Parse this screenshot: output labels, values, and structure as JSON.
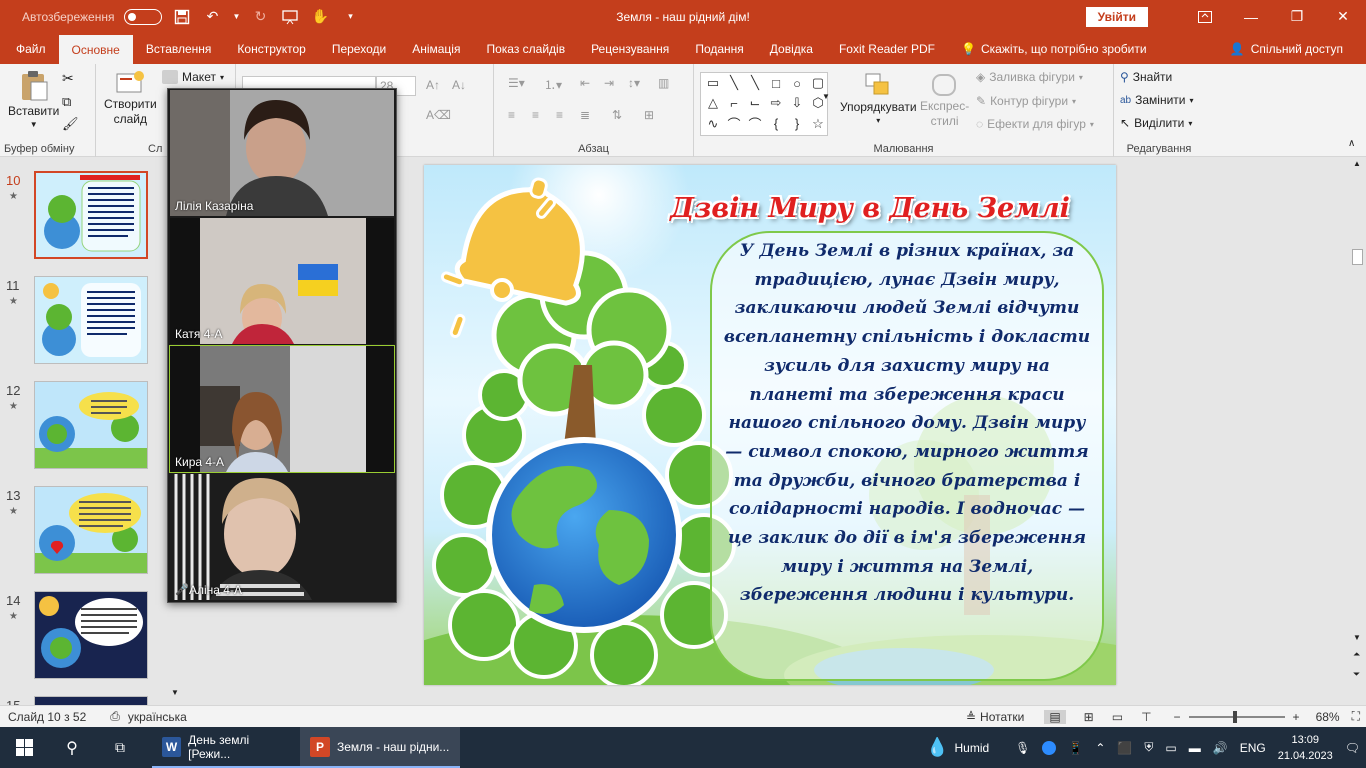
{
  "titlebar": {
    "autosave_label": "Автозбереження",
    "title": "Земля - наш рідний дім!",
    "signin": "Увійти"
  },
  "tabs": [
    "Файл",
    "Основне",
    "Вставлення",
    "Конструктор",
    "Переходи",
    "Анімація",
    "Показ слайдів",
    "Рецензування",
    "Подання",
    "Довідка",
    "Foxit Reader PDF"
  ],
  "tell_me": "Скажіть, що потрібно зробити",
  "share": "Спільний доступ",
  "ribbon": {
    "paste": "Вставити",
    "clipboard_group": "Буфер обміну",
    "new_slide_line1": "Створити",
    "new_slide_line2": "слайд",
    "layout": "Макет",
    "slides_group": "Сл",
    "font_size": "28",
    "paragraph_group": "Абзац",
    "arrange": "Упорядкувати",
    "quick_styles_line1": "Експрес-",
    "quick_styles_line2": "стилі",
    "shape_fill": "Заливка фігури",
    "shape_outline": "Контур фігури",
    "shape_effects": "Ефекти для фігур",
    "drawing_group": "Малювання",
    "find": "Знайти",
    "replace": "Замінити",
    "select": "Виділити",
    "editing_group": "Редагування"
  },
  "thumbnails": [
    {
      "num": "10",
      "star": "★"
    },
    {
      "num": "11",
      "star": "★"
    },
    {
      "num": "12",
      "star": "★"
    },
    {
      "num": "13",
      "star": "★"
    },
    {
      "num": "14",
      "star": "★"
    },
    {
      "num": "15",
      "star": ""
    }
  ],
  "slide": {
    "title": "Дзвін Миру в День Землі",
    "body": "У День Землі в різних країнах, за традицією, лунає Дзвін миру, закликаючи людей Землі відчути всепланетну спільність і докласти зусиль для захисту миру на планеті та збереження краси нашого спільного дому. Дзвін миру — символ спокою, мирного життя та дружби, вічного братерства і солідарності народів. І водночас — це заклик до дії в ім'я збереження миру і життя на Землі, збереження людини і культури."
  },
  "video_participants": [
    {
      "name": "Лілія Казаріна",
      "muted": false
    },
    {
      "name": "Катя  4-А",
      "muted": false
    },
    {
      "name": "Кира 4-А",
      "muted": false
    },
    {
      "name": "Аліна 4-А",
      "muted": true
    }
  ],
  "status": {
    "slide_counter": "Слайд 10 з 52",
    "language": "українська",
    "notes": "Нотатки",
    "zoom": "68%"
  },
  "taskbar": {
    "apps": [
      {
        "label": "День землі [Режи...",
        "icon": "W"
      },
      {
        "label": "Земля - наш рідни...",
        "icon": "P"
      }
    ],
    "weather": "Humid",
    "lang": "ENG",
    "time": "13:09",
    "date": "21.04.2023"
  },
  "colors": {
    "accent": "#c43e1c",
    "title_red": "#e02020",
    "text_navy": "#0f2a6b",
    "selection": "#d24726"
  }
}
